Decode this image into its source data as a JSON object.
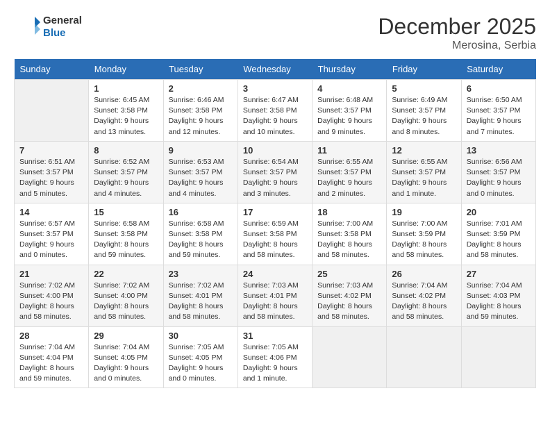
{
  "header": {
    "logo_line1": "General",
    "logo_line2": "Blue",
    "month_year": "December 2025",
    "location": "Merosina, Serbia"
  },
  "days_of_week": [
    "Sunday",
    "Monday",
    "Tuesday",
    "Wednesday",
    "Thursday",
    "Friday",
    "Saturday"
  ],
  "weeks": [
    [
      {
        "day": "",
        "empty": true
      },
      {
        "day": "1",
        "sunrise": "Sunrise: 6:45 AM",
        "sunset": "Sunset: 3:58 PM",
        "daylight": "Daylight: 9 hours and 13 minutes."
      },
      {
        "day": "2",
        "sunrise": "Sunrise: 6:46 AM",
        "sunset": "Sunset: 3:58 PM",
        "daylight": "Daylight: 9 hours and 12 minutes."
      },
      {
        "day": "3",
        "sunrise": "Sunrise: 6:47 AM",
        "sunset": "Sunset: 3:58 PM",
        "daylight": "Daylight: 9 hours and 10 minutes."
      },
      {
        "day": "4",
        "sunrise": "Sunrise: 6:48 AM",
        "sunset": "Sunset: 3:57 PM",
        "daylight": "Daylight: 9 hours and 9 minutes."
      },
      {
        "day": "5",
        "sunrise": "Sunrise: 6:49 AM",
        "sunset": "Sunset: 3:57 PM",
        "daylight": "Daylight: 9 hours and 8 minutes."
      },
      {
        "day": "6",
        "sunrise": "Sunrise: 6:50 AM",
        "sunset": "Sunset: 3:57 PM",
        "daylight": "Daylight: 9 hours and 7 minutes."
      }
    ],
    [
      {
        "day": "7",
        "sunrise": "Sunrise: 6:51 AM",
        "sunset": "Sunset: 3:57 PM",
        "daylight": "Daylight: 9 hours and 5 minutes."
      },
      {
        "day": "8",
        "sunrise": "Sunrise: 6:52 AM",
        "sunset": "Sunset: 3:57 PM",
        "daylight": "Daylight: 9 hours and 4 minutes."
      },
      {
        "day": "9",
        "sunrise": "Sunrise: 6:53 AM",
        "sunset": "Sunset: 3:57 PM",
        "daylight": "Daylight: 9 hours and 4 minutes."
      },
      {
        "day": "10",
        "sunrise": "Sunrise: 6:54 AM",
        "sunset": "Sunset: 3:57 PM",
        "daylight": "Daylight: 9 hours and 3 minutes."
      },
      {
        "day": "11",
        "sunrise": "Sunrise: 6:55 AM",
        "sunset": "Sunset: 3:57 PM",
        "daylight": "Daylight: 9 hours and 2 minutes."
      },
      {
        "day": "12",
        "sunrise": "Sunrise: 6:55 AM",
        "sunset": "Sunset: 3:57 PM",
        "daylight": "Daylight: 9 hours and 1 minute."
      },
      {
        "day": "13",
        "sunrise": "Sunrise: 6:56 AM",
        "sunset": "Sunset: 3:57 PM",
        "daylight": "Daylight: 9 hours and 0 minutes."
      }
    ],
    [
      {
        "day": "14",
        "sunrise": "Sunrise: 6:57 AM",
        "sunset": "Sunset: 3:57 PM",
        "daylight": "Daylight: 9 hours and 0 minutes."
      },
      {
        "day": "15",
        "sunrise": "Sunrise: 6:58 AM",
        "sunset": "Sunset: 3:58 PM",
        "daylight": "Daylight: 8 hours and 59 minutes."
      },
      {
        "day": "16",
        "sunrise": "Sunrise: 6:58 AM",
        "sunset": "Sunset: 3:58 PM",
        "daylight": "Daylight: 8 hours and 59 minutes."
      },
      {
        "day": "17",
        "sunrise": "Sunrise: 6:59 AM",
        "sunset": "Sunset: 3:58 PM",
        "daylight": "Daylight: 8 hours and 58 minutes."
      },
      {
        "day": "18",
        "sunrise": "Sunrise: 7:00 AM",
        "sunset": "Sunset: 3:58 PM",
        "daylight": "Daylight: 8 hours and 58 minutes."
      },
      {
        "day": "19",
        "sunrise": "Sunrise: 7:00 AM",
        "sunset": "Sunset: 3:59 PM",
        "daylight": "Daylight: 8 hours and 58 minutes."
      },
      {
        "day": "20",
        "sunrise": "Sunrise: 7:01 AM",
        "sunset": "Sunset: 3:59 PM",
        "daylight": "Daylight: 8 hours and 58 minutes."
      }
    ],
    [
      {
        "day": "21",
        "sunrise": "Sunrise: 7:02 AM",
        "sunset": "Sunset: 4:00 PM",
        "daylight": "Daylight: 8 hours and 58 minutes."
      },
      {
        "day": "22",
        "sunrise": "Sunrise: 7:02 AM",
        "sunset": "Sunset: 4:00 PM",
        "daylight": "Daylight: 8 hours and 58 minutes."
      },
      {
        "day": "23",
        "sunrise": "Sunrise: 7:02 AM",
        "sunset": "Sunset: 4:01 PM",
        "daylight": "Daylight: 8 hours and 58 minutes."
      },
      {
        "day": "24",
        "sunrise": "Sunrise: 7:03 AM",
        "sunset": "Sunset: 4:01 PM",
        "daylight": "Daylight: 8 hours and 58 minutes."
      },
      {
        "day": "25",
        "sunrise": "Sunrise: 7:03 AM",
        "sunset": "Sunset: 4:02 PM",
        "daylight": "Daylight: 8 hours and 58 minutes."
      },
      {
        "day": "26",
        "sunrise": "Sunrise: 7:04 AM",
        "sunset": "Sunset: 4:02 PM",
        "daylight": "Daylight: 8 hours and 58 minutes."
      },
      {
        "day": "27",
        "sunrise": "Sunrise: 7:04 AM",
        "sunset": "Sunset: 4:03 PM",
        "daylight": "Daylight: 8 hours and 59 minutes."
      }
    ],
    [
      {
        "day": "28",
        "sunrise": "Sunrise: 7:04 AM",
        "sunset": "Sunset: 4:04 PM",
        "daylight": "Daylight: 8 hours and 59 minutes."
      },
      {
        "day": "29",
        "sunrise": "Sunrise: 7:04 AM",
        "sunset": "Sunset: 4:05 PM",
        "daylight": "Daylight: 9 hours and 0 minutes."
      },
      {
        "day": "30",
        "sunrise": "Sunrise: 7:05 AM",
        "sunset": "Sunset: 4:05 PM",
        "daylight": "Daylight: 9 hours and 0 minutes."
      },
      {
        "day": "31",
        "sunrise": "Sunrise: 7:05 AM",
        "sunset": "Sunset: 4:06 PM",
        "daylight": "Daylight: 9 hours and 1 minute."
      },
      {
        "day": "",
        "empty": true
      },
      {
        "day": "",
        "empty": true
      },
      {
        "day": "",
        "empty": true
      }
    ]
  ]
}
